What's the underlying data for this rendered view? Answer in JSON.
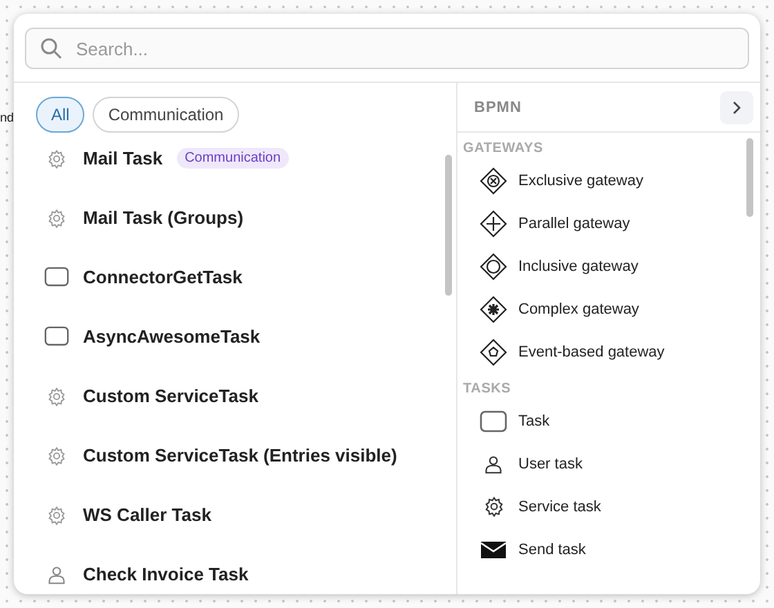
{
  "canvas_label": "nd",
  "search": {
    "placeholder": "Search..."
  },
  "filters": [
    {
      "label": "All",
      "selected": true
    },
    {
      "label": "Communication",
      "selected": false
    }
  ],
  "templates": [
    {
      "name": "Mail Task",
      "kind": "service",
      "tag": "Communication"
    },
    {
      "name": "Mail Task (Groups)",
      "kind": "service"
    },
    {
      "name": "ConnectorGetTask",
      "kind": "task"
    },
    {
      "name": "AsyncAwesomeTask",
      "kind": "task"
    },
    {
      "name": "Custom ServiceTask",
      "kind": "service"
    },
    {
      "name": "Custom ServiceTask (Entries visible)",
      "kind": "service"
    },
    {
      "name": "WS Caller Task",
      "kind": "service"
    },
    {
      "name": "Check Invoice Task",
      "kind": "user"
    }
  ],
  "palette": {
    "title": "BPMN",
    "groups": [
      {
        "heading": "GATEWAYS",
        "items": [
          {
            "label": "Exclusive gateway",
            "kind": "exclusive"
          },
          {
            "label": "Parallel gateway",
            "kind": "parallel"
          },
          {
            "label": "Inclusive gateway",
            "kind": "inclusive"
          },
          {
            "label": "Complex gateway",
            "kind": "complex"
          },
          {
            "label": "Event-based gateway",
            "kind": "event"
          }
        ]
      },
      {
        "heading": "TASKS",
        "items": [
          {
            "label": "Task",
            "kind": "task"
          },
          {
            "label": "User task",
            "kind": "user"
          },
          {
            "label": "Service task",
            "kind": "service"
          },
          {
            "label": "Send task",
            "kind": "send"
          }
        ]
      }
    ]
  }
}
